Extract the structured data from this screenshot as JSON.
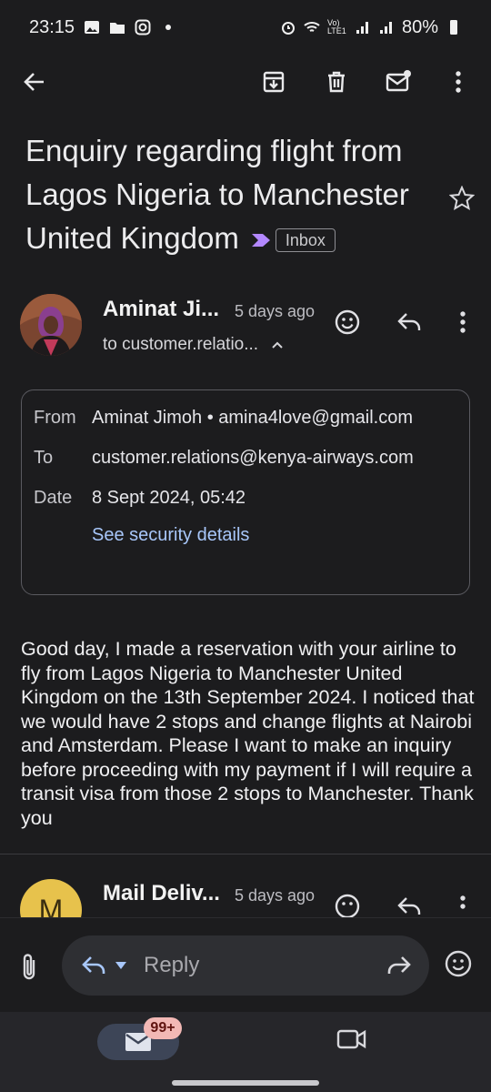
{
  "status_bar": {
    "time": "23:15",
    "battery": "80%",
    "network": "Vo) LTE1"
  },
  "toolbar": {
    "back": "arrow-back-icon",
    "archive": "archive-icon",
    "delete": "delete-icon",
    "mark_unread": "mark-unread-icon",
    "more": "more-vert-icon"
  },
  "email": {
    "subject": "Enquiry regarding flight from Lagos Nigeria to Manchester United Kingdom",
    "label": "Inbox",
    "sender_short": "Aminat Ji...",
    "time_ago": "5 days ago",
    "to_short": "to customer.relatio...",
    "details": {
      "from_label": "From",
      "from_value": "Aminat Jimoh • amina4love@gmail.com",
      "to_label": "To",
      "to_value": "customer.relations@kenya-airways.com",
      "date_label": "Date",
      "date_value": "8 Sept 2024, 05:42",
      "security_link": "See security details"
    },
    "body": "Good day, I made a reservation with your airline to fly from Lagos Nigeria to Manchester United Kingdom on the 13th September 2024. I noticed that we would have 2 stops and change flights at Nairobi and Amsterdam. Please I want to make an inquiry before proceeding with my payment if I will require a transit visa from those 2 stops to Manchester. Thank you"
  },
  "second_message": {
    "avatar_letter": "M",
    "sender_short": "Mail Deliv...",
    "time_ago": "5 days ago"
  },
  "reply_bar": {
    "placeholder": "Reply"
  },
  "bottom_nav": {
    "mail_badge": "99+"
  },
  "colors": {
    "background": "#1c1c1e",
    "link": "#a8c7fa",
    "importance": "#b388ff",
    "badge": "#f2b8b5"
  }
}
